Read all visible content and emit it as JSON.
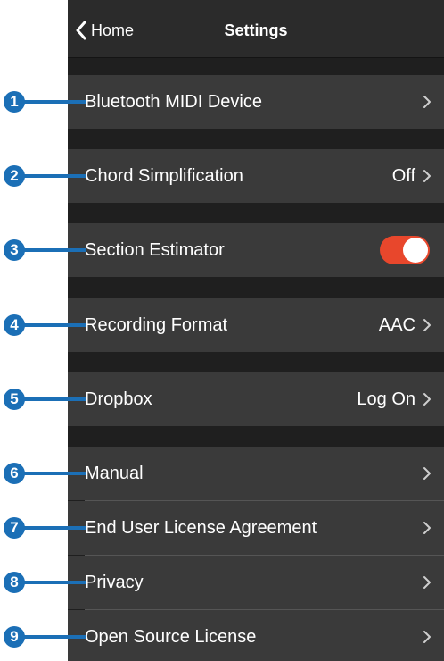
{
  "nav": {
    "back_label": "Home",
    "title": "Settings"
  },
  "rows": [
    {
      "label": "Bluetooth MIDI Device",
      "value": ""
    },
    {
      "label": "Chord Simplification",
      "value": "Off"
    },
    {
      "label": "Section Estimator",
      "toggle_on": true
    },
    {
      "label": "Recording Format",
      "value": "AAC"
    },
    {
      "label": "Dropbox",
      "value": "Log On"
    },
    {
      "label": "Manual",
      "value": ""
    },
    {
      "label": "End User License Agreement",
      "value": ""
    },
    {
      "label": "Privacy",
      "value": ""
    },
    {
      "label": "Open Source License",
      "value": ""
    }
  ],
  "callouts": [
    "1",
    "2",
    "3",
    "4",
    "5",
    "6",
    "7",
    "8",
    "9"
  ],
  "colors": {
    "callout_blue": "#1b6fb6",
    "toggle_on": "#e8472c",
    "row_bg": "#3a3a3a",
    "gap_bg": "#1f1f1f"
  }
}
